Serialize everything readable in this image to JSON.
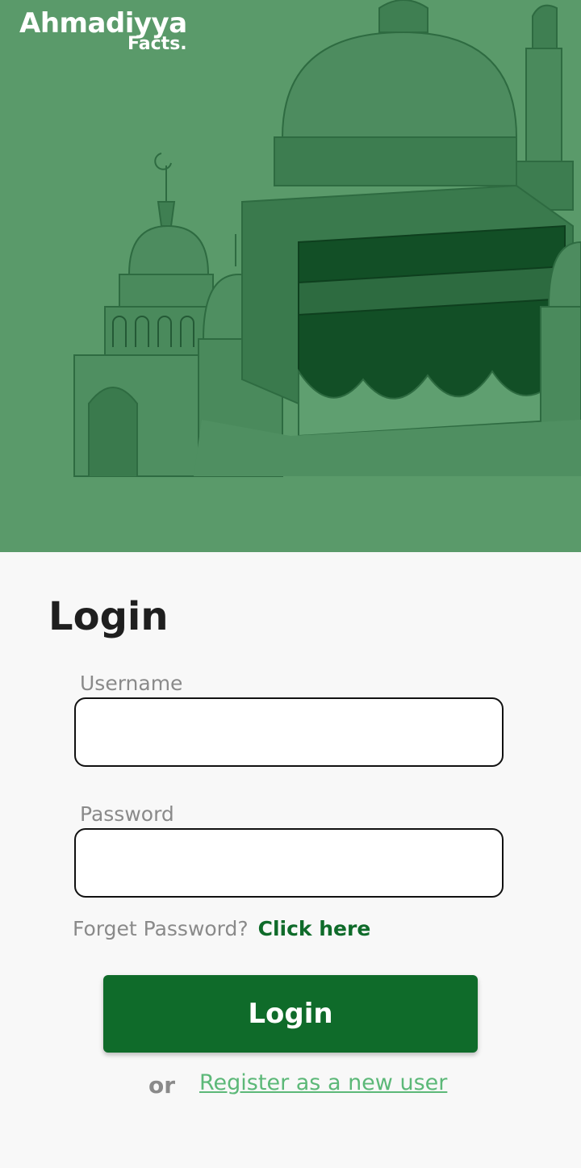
{
  "app": {
    "logo_line1": "Ahmadiyya",
    "logo_line2": "Facts."
  },
  "hero": {
    "illustration": "mosque-kaaba-sketch",
    "background_color": "#5a9a6a",
    "ink_color": "#1f5e35"
  },
  "form": {
    "title": "Login",
    "username_label": "Username",
    "username_value": "",
    "password_label": "Password",
    "password_value": "",
    "forgot_text": "Forget Password?",
    "forgot_link": "Click here",
    "login_button": "Login",
    "or_text": "or",
    "register_link": "Register as a new user"
  },
  "colors": {
    "primary": "#0f6b2a",
    "link": "#5cb878",
    "muted_text": "#8a8a8a",
    "page_bg": "#f8f8f8"
  }
}
